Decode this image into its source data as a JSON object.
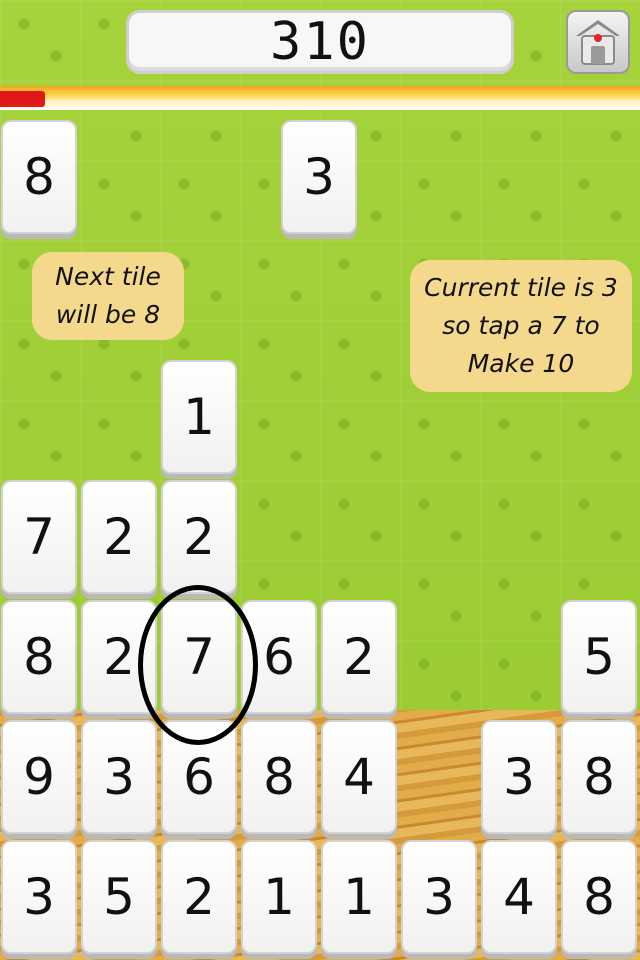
{
  "score": "310",
  "progress_fraction": 0.07,
  "home_button_icon": "home-icon",
  "hints": {
    "next": [
      "Next tile",
      "will be 8"
    ],
    "current": [
      "Current tile is 3",
      "so tap a 7 to",
      "Make 10"
    ]
  },
  "upcoming_tiles": [
    {
      "id": "next",
      "value": "8"
    },
    {
      "id": "current",
      "value": "3"
    }
  ],
  "board": [
    {
      "col": 2,
      "row": 0,
      "value": "1"
    },
    {
      "col": 0,
      "row": 1,
      "value": "7"
    },
    {
      "col": 1,
      "row": 1,
      "value": "2"
    },
    {
      "col": 2,
      "row": 1,
      "value": "2"
    },
    {
      "col": 0,
      "row": 2,
      "value": "8"
    },
    {
      "col": 1,
      "row": 2,
      "value": "2"
    },
    {
      "col": 2,
      "row": 2,
      "value": "7"
    },
    {
      "col": 3,
      "row": 2,
      "value": "6"
    },
    {
      "col": 4,
      "row": 2,
      "value": "2"
    },
    {
      "col": 7,
      "row": 2,
      "value": "5"
    },
    {
      "col": 0,
      "row": 3,
      "value": "9"
    },
    {
      "col": 1,
      "row": 3,
      "value": "3"
    },
    {
      "col": 2,
      "row": 3,
      "value": "6"
    },
    {
      "col": 3,
      "row": 3,
      "value": "8"
    },
    {
      "col": 4,
      "row": 3,
      "value": "4"
    },
    {
      "col": 6,
      "row": 3,
      "value": "3"
    },
    {
      "col": 7,
      "row": 3,
      "value": "8"
    },
    {
      "col": 0,
      "row": 4,
      "value": "3"
    },
    {
      "col": 1,
      "row": 4,
      "value": "5"
    },
    {
      "col": 2,
      "row": 4,
      "value": "2"
    },
    {
      "col": 3,
      "row": 4,
      "value": "1"
    },
    {
      "col": 4,
      "row": 4,
      "value": "1"
    },
    {
      "col": 5,
      "row": 4,
      "value": "3"
    },
    {
      "col": 6,
      "row": 4,
      "value": "4"
    },
    {
      "col": 7,
      "row": 4,
      "value": "8"
    }
  ],
  "highlighted_tile": {
    "col": 2,
    "row": 2
  }
}
